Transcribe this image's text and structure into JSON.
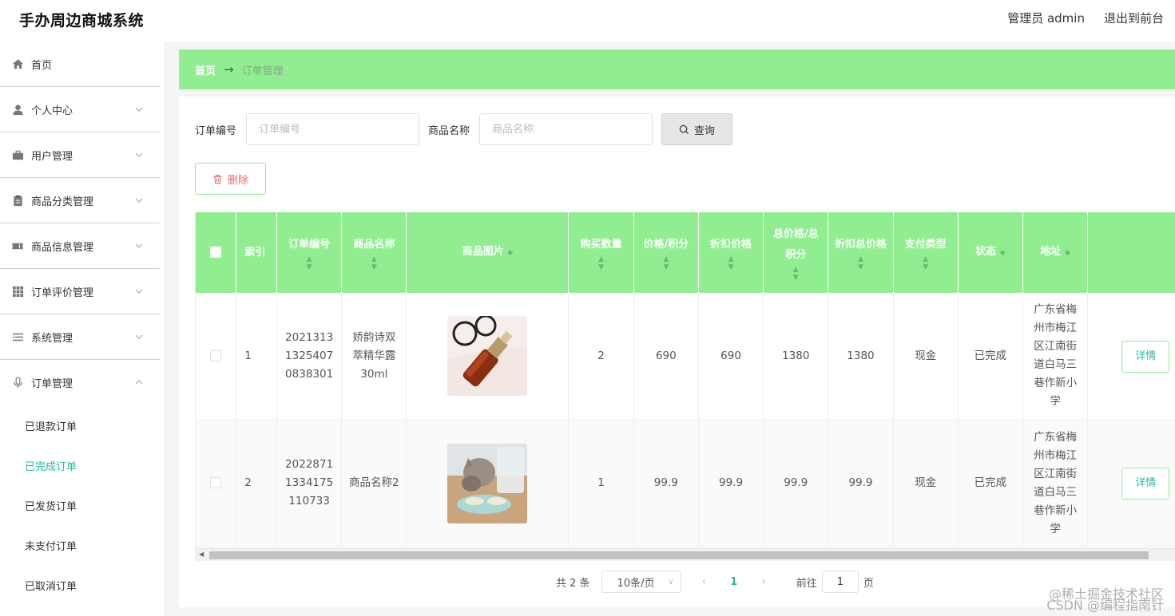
{
  "app": {
    "title": "手办周边商城系统"
  },
  "header": {
    "user_label": "管理员 admin",
    "exit_label": "退出到前台"
  },
  "sidebar": {
    "items": [
      {
        "label": "首页",
        "icon": "home-icon"
      },
      {
        "label": "个人中心",
        "icon": "user-icon"
      },
      {
        "label": "用户管理",
        "icon": "briefcase-icon"
      },
      {
        "label": "商品分类管理",
        "icon": "clipboard-icon"
      },
      {
        "label": "商品信息管理",
        "icon": "ticket-icon"
      },
      {
        "label": "订单评价管理",
        "icon": "grid-icon"
      },
      {
        "label": "系统管理",
        "icon": "list-icon"
      },
      {
        "label": "订单管理",
        "icon": "microphone-icon"
      }
    ],
    "sub_items": [
      {
        "label": "已退款订单",
        "active": false
      },
      {
        "label": "已完成订单",
        "active": true
      },
      {
        "label": "已发货订单",
        "active": false
      },
      {
        "label": "未支付订单",
        "active": false
      },
      {
        "label": "已取消订单",
        "active": false
      }
    ]
  },
  "breadcrumb": {
    "home": "首页",
    "separator": "→",
    "current": "订单管理"
  },
  "search": {
    "order_no_label": "订单编号",
    "order_no_placeholder": "订单编号",
    "product_name_label": "商品名称",
    "product_name_placeholder": "商品名称",
    "query_label": "查询"
  },
  "toolbar": {
    "delete_label": "删除"
  },
  "table": {
    "headers": {
      "index": "索引",
      "order_no": "订单编号",
      "product_name": "商品名称",
      "product_image": "商品图片",
      "quantity": "购买数量",
      "price": "价格/积分",
      "discount_price": "折扣价格",
      "total": "总价格/总积分",
      "discount_total": "折扣总价格",
      "pay_type": "支付类型",
      "status": "状态",
      "address": "地址"
    },
    "rows": [
      {
        "index": "1",
        "order_no": "20213131325407 0838301",
        "product_name": "娇韵诗双萃精华露30ml",
        "quantity": "2",
        "price": "690",
        "discount_price": "690",
        "total": "1380",
        "discount_total": "1380",
        "pay_type": "现金",
        "status": "已完成",
        "address": "广东省梅州市梅江区江南街道白马三巷作新小学",
        "detail_label": "详情"
      },
      {
        "index": "2",
        "order_no": "20228711334175 110733",
        "product_name": "商品名称2",
        "quantity": "1",
        "price": "99.9",
        "discount_price": "99.9",
        "total": "99.9",
        "discount_total": "99.9",
        "pay_type": "现金",
        "status": "已完成",
        "address": "广东省梅州市梅江区江南街道白马三巷作新小学",
        "detail_label": "详情"
      }
    ]
  },
  "pagination": {
    "total_text": "共 2 条",
    "page_size": "10条/页",
    "current_page": "1",
    "goto_label": "前往",
    "goto_value": "1",
    "page_unit": "页"
  },
  "watermark": {
    "line1": "@稀土掘金技术社区",
    "line2": "CSDN @编程指南针"
  },
  "colors": {
    "accent_green": "#90ee90",
    "active_teal": "#28b9a2",
    "delete_red": "#e86a6a"
  }
}
